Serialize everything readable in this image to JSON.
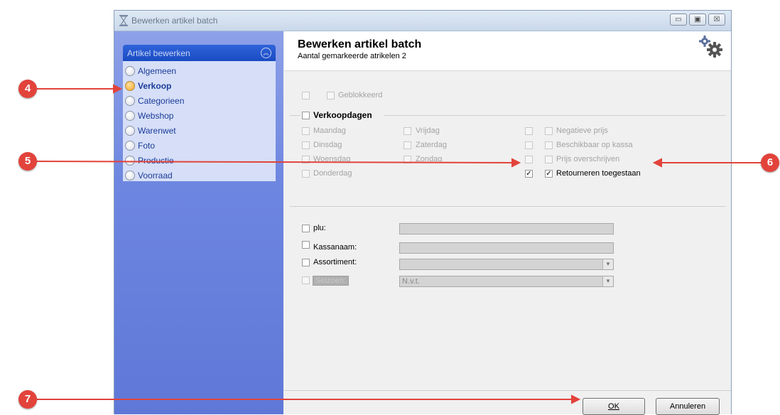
{
  "window": {
    "title": "Bewerken artikel batch",
    "controls": {
      "minimize": "▭",
      "maximize": "▣",
      "close": "☒"
    }
  },
  "sidebar": {
    "group_title": "Artikel bewerken",
    "collapse_icon": "double-chevron-up-icon",
    "items": [
      {
        "label": "Algemeen",
        "active": false
      },
      {
        "label": "Verkoop",
        "active": true
      },
      {
        "label": "Categorieen",
        "active": false
      },
      {
        "label": "Webshop",
        "active": false
      },
      {
        "label": "Warenwet",
        "active": false
      },
      {
        "label": "Foto",
        "active": false
      },
      {
        "label": "Productie",
        "active": false
      },
      {
        "label": "Voorraad",
        "active": false
      }
    ]
  },
  "header": {
    "title": "Bewerken artikel batch",
    "subtitle": "Aantal gemarkeerde atrikelen 2",
    "icon": "gears-icon"
  },
  "form": {
    "geblokkeerd": "Geblokkeerd",
    "verkoopdagen": "Verkoopdagen",
    "days": {
      "maandag": "Maandag",
      "dinsdag": "Dinsdag",
      "woensdag": "Woensdag",
      "donderdag": "Donderdag",
      "vrijdag": "Vrijdag",
      "zaterdag": "Zaterdag",
      "zondag": "Zondag"
    },
    "options": {
      "negatieve_prijs": "Negatieve prijs",
      "beschikbaar_kassa": "Beschikbaar op kassa",
      "prijs_overschrijven": "Prijs overschrijven",
      "retourneren": "Retourneren toegestaan"
    },
    "checkmark": "✓",
    "fields": {
      "plu_label": "plu:",
      "kassanaam_label": "Kassanaam:",
      "assortiment_label": "Assortiment:",
      "seizoen_label": "Seizoen:",
      "seizoen_value": "N.v.t.",
      "dropdown_arrow": "▼"
    }
  },
  "buttons": {
    "ok": "OK",
    "annuleren": "Annuleren"
  },
  "callouts": {
    "c4": "4",
    "c5": "5",
    "c6": "6",
    "c7": "7"
  },
  "colors": {
    "callout": "#e2433b",
    "sidebar_head": "#1a4bc3",
    "sidebar_bg": "#6d86e0"
  }
}
